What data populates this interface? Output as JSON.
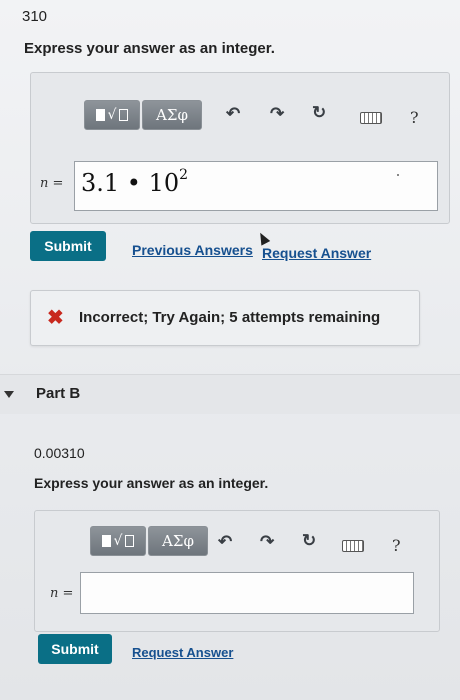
{
  "part_a": {
    "value": "310",
    "prompt": "Express your answer as an integer.",
    "toolbar": {
      "template_symbol": "√",
      "greek_label": "ΑΣφ",
      "help_label": "?"
    },
    "variable": "n =",
    "answer": {
      "base": "3.1 • 10",
      "exponent": "2"
    },
    "submit_label": "Submit",
    "previous_answers_label": "Previous Answers",
    "request_answer_label": "Request Answer",
    "feedback": "Incorrect; Try Again; 5 attempts remaining"
  },
  "part_b": {
    "title": "Part B",
    "value": "0.00310",
    "prompt": "Express your answer as an integer.",
    "toolbar": {
      "template_symbol": "√",
      "greek_label": "ΑΣφ",
      "help_label": "?"
    },
    "variable": "n =",
    "answer_value": "",
    "submit_label": "Submit",
    "request_answer_label": "Request Answer"
  },
  "colors": {
    "submit_bg": "#0a6f86",
    "link": "#16508f",
    "error": "#c8281e"
  },
  "icons": [
    "templates-icon",
    "greek-letters-icon",
    "undo-icon",
    "redo-icon",
    "reset-icon",
    "keyboard-icon",
    "help-icon",
    "incorrect-x-icon",
    "collapse-triangle-icon"
  ]
}
